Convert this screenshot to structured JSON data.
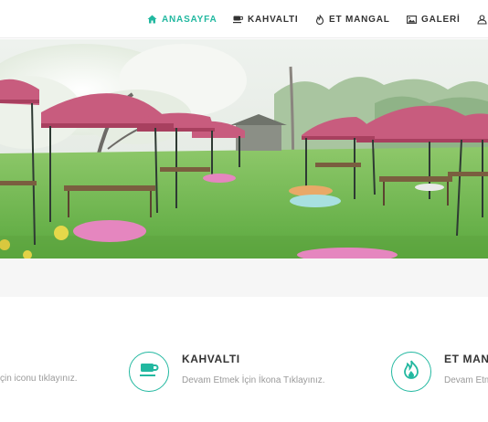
{
  "nav": {
    "items": [
      {
        "label": "ANASAYFA",
        "icon": "home-icon",
        "active": true
      },
      {
        "label": "KAHVALTI",
        "icon": "coffee-cup-icon",
        "active": false
      },
      {
        "label": "ET MANGAL",
        "icon": "fire-icon",
        "active": false
      },
      {
        "label": "GALERİ",
        "icon": "image-icon",
        "active": false
      },
      {
        "label": "",
        "icon": "user-icon",
        "active": false
      }
    ]
  },
  "colors": {
    "accent": "#22b8a0",
    "nav_text": "#333333",
    "muted_text": "#9a9a9a"
  },
  "hero": {
    "image": "garden-tents-photo"
  },
  "features": [
    {
      "title": "",
      "desc": "çin iconu tıklayınız.",
      "icon": ""
    },
    {
      "title": "KAHVALTI",
      "desc": "Devam Etmek İçin İkona Tıklayınız.",
      "icon": "coffee-cup-icon"
    },
    {
      "title": "ET MAN",
      "desc": "Devam Etm",
      "icon": "fire-icon"
    }
  ]
}
